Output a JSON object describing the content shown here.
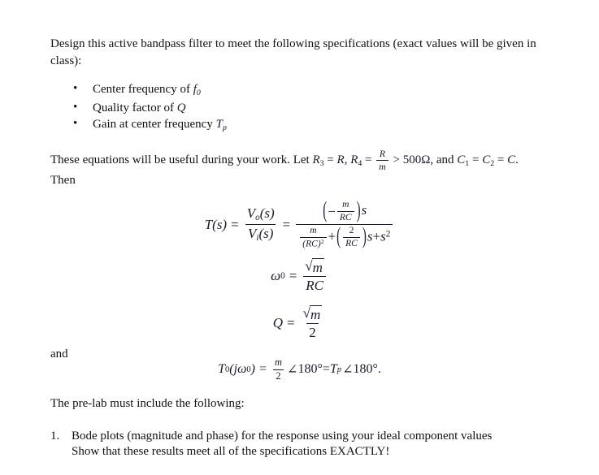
{
  "document": {
    "intro_paragraph": "Design this active bandpass filter to meet the following specifications (exact values will be given in class):",
    "specs": [
      {
        "text_before": "Center frequency of ",
        "symbol": "f",
        "sub": "0",
        "text_after": ""
      },
      {
        "text_before": "Quality factor of ",
        "symbol": "Q",
        "sub": "",
        "text_after": ""
      },
      {
        "text_before": "Gain at center frequency ",
        "symbol": "T",
        "sub": "p",
        "text_after": ""
      }
    ],
    "equations_intro": {
      "line1_a": "These equations will be useful during your work.  Let ",
      "r3": "R",
      "r3_sub": "3",
      "eq1": " = ",
      "r": "R",
      "comma1": ", ",
      "r4": "R",
      "r4_sub": "4",
      "eq2": " = ",
      "frac_num": "R",
      "frac_den": "m",
      "gt": " > ",
      "ohm_value": "500Ω",
      "and_text": ", and ",
      "c1": "C",
      "c1_sub": "1",
      "eq3": " = ",
      "c2": "C",
      "c2_sub": "2",
      "eq4": " = ",
      "c": "C",
      "period": ".",
      "line2": "Then"
    },
    "equation_transfer": {
      "lhs": "T",
      "lhs_arg": "(s)",
      "equals": "=",
      "ratio_num": "V",
      "ratio_num_sub": "o",
      "ratio_num_arg": "(s)",
      "ratio_den": "V",
      "ratio_den_sub": "i",
      "ratio_den_arg": "(s)",
      "equals2": "=",
      "numerator_sign": "−",
      "numerator_frac_num": "m",
      "numerator_frac_den": "RC",
      "numerator_tail": "s",
      "den_first_num": "m",
      "den_first_den": "(RC)",
      "den_first_den_exp": "2",
      "den_plus": "+",
      "den_second_num": "2",
      "den_second_den": "RC",
      "den_second_tail": "s",
      "den_plus2": "+",
      "den_last": "s",
      "den_last_exp": "2"
    },
    "equation_omega0": {
      "lhs": "ω",
      "lhs_sub": "0",
      "equals": "=",
      "num_radicand": "m",
      "den": "RC"
    },
    "equation_Q": {
      "lhs": "Q",
      "equals": "=",
      "num_radicand": "m",
      "den": "2"
    },
    "and_label": "and",
    "equation_T0": {
      "lhs": "T",
      "lhs_sub": "0",
      "lhs_arg_open": "(",
      "lhs_j": "j",
      "lhs_omega": "ω",
      "lhs_omega_sub": "0",
      "lhs_arg_close": ")",
      "equals": "=",
      "frac_num": "m",
      "frac_den": "2",
      "angle1": "∠",
      "deg1": "180°",
      "equals2": "=",
      "tp": "T",
      "tp_sub": "p",
      "angle2": "∠",
      "deg2": "180°",
      "period": "."
    },
    "prelab_heading": "The pre-lab must include the following:",
    "prelab_items": [
      {
        "number": "1.",
        "line1": "Bode plots (magnitude and phase) for the response using your ideal component values",
        "line2": "Show that these results meet all of the specifications  EXACTLY!"
      }
    ]
  },
  "colors": {
    "page_background": "#ffffff",
    "body_text": "#111111",
    "math_text": "#1b1b2f"
  }
}
